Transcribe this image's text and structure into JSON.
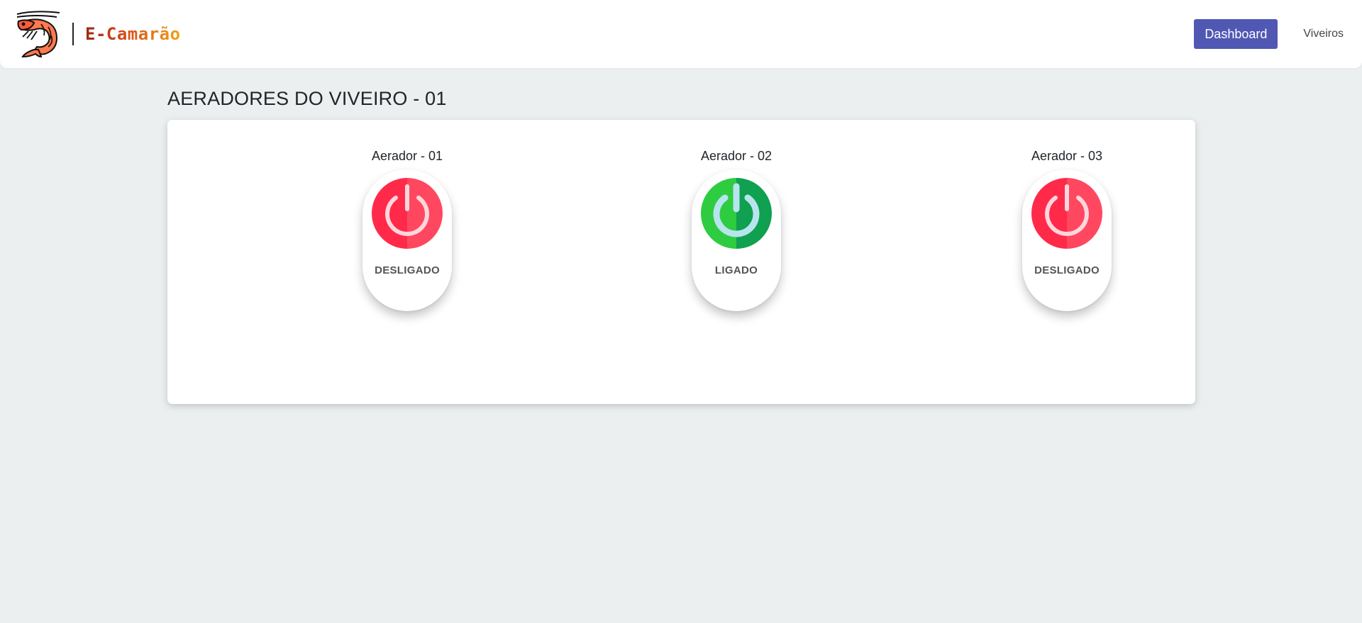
{
  "brand": {
    "name": "E-Camarão",
    "logo_icon": "shrimp-icon"
  },
  "nav": {
    "dashboard_label": "Dashboard",
    "viveiros_label": "Viveiros",
    "accent": "#5058b4"
  },
  "page": {
    "title": "AERADORES DO VIVEIRO - 01"
  },
  "aeradores": [
    {
      "title": "Aerador - 01",
      "status": "DESLIGADO",
      "on": false,
      "icon": "power-icon",
      "color": "#ff3250"
    },
    {
      "title": "Aerador - 02",
      "status": "LIGADO",
      "on": true,
      "icon": "power-icon",
      "color": "#2ecc40"
    },
    {
      "title": "Aerador - 03",
      "status": "DESLIGADO",
      "on": false,
      "icon": "power-icon",
      "color": "#ff3250"
    }
  ]
}
